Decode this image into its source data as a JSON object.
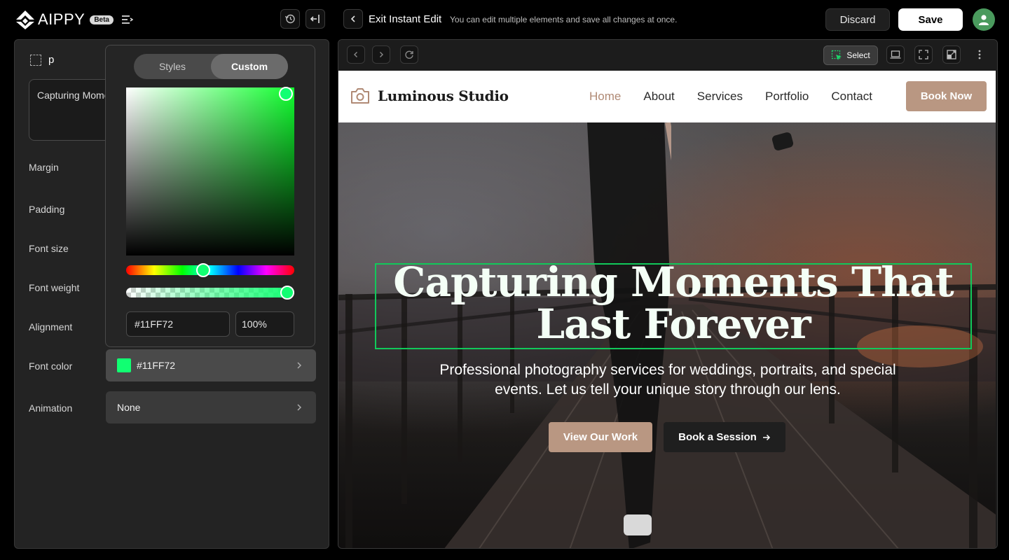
{
  "app": {
    "name": "AIPPY",
    "badge": "Beta"
  },
  "toolbar": {
    "exit_label": "Exit Instant Edit",
    "exit_hint": "You can edit multiple elements and save all changes at once.",
    "discard_label": "Discard",
    "save_label": "Save"
  },
  "panel": {
    "element_tag": "p",
    "text_preview": "Capturing Moments That Last Forever",
    "props": {
      "margin": "Margin",
      "padding": "Padding",
      "font_size": "Font size",
      "font_weight": "Font weight",
      "alignment": "Alignment",
      "font_color": "Font color",
      "animation": "Animation"
    },
    "font_color_value": "#11FF72",
    "animation_value": "None"
  },
  "picker": {
    "tabs": [
      "Styles",
      "Custom"
    ],
    "active_tab": "Custom",
    "hex": "#11FF72",
    "alpha": "100%"
  },
  "preview": {
    "select_label": "Select",
    "site": {
      "brand": "Luminous Studio",
      "nav": [
        "Home",
        "About",
        "Services",
        "Portfolio",
        "Contact"
      ],
      "active_nav": "Home",
      "cta": "Book Now",
      "headline": "Capturing Moments That Last Forever",
      "subtitle": "Professional photography services for weddings, portraits, and special events. Let us tell your unique story through our lens.",
      "primary_button": "View Our Work",
      "secondary_button": "Book a Session"
    }
  },
  "colors": {
    "selected": "#11FF72",
    "accent": "#B99782",
    "avatar": "#4A9A5D",
    "highlight_border": "#11C95A"
  }
}
